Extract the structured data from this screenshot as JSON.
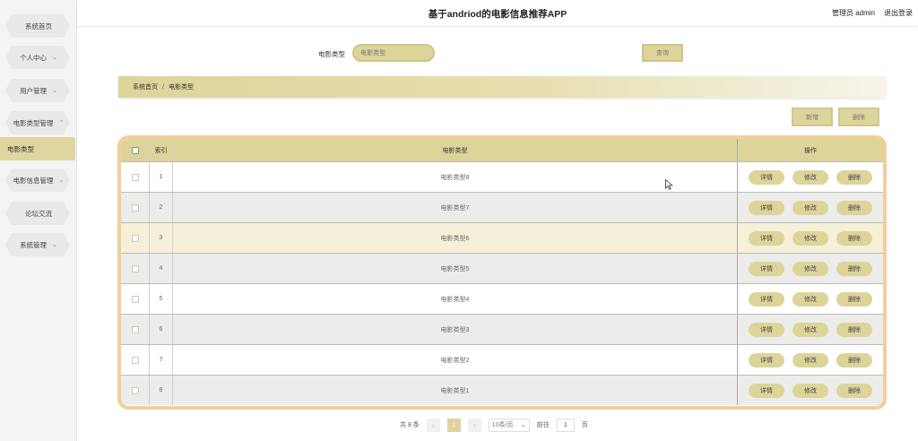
{
  "header": {
    "title": "基于andriod的电影信息推荐APP",
    "user": "管理员 admin",
    "logout": "退出登录"
  },
  "sidebar": {
    "items": [
      {
        "label": "系统首页",
        "chevron": false
      },
      {
        "label": "个人中心",
        "chevron": "⌄"
      },
      {
        "label": "用户管理",
        "chevron": "⌄"
      },
      {
        "label": "电影类型管理",
        "chevron": "⌃"
      },
      {
        "label": "电影类型",
        "chevron": false,
        "active": true
      },
      {
        "label": "电影信息管理",
        "chevron": "⌄"
      },
      {
        "label": "论坛交流",
        "chevron": false
      },
      {
        "label": "系统管理",
        "chevron": "⌄"
      }
    ]
  },
  "search": {
    "label": "电影类型",
    "placeholder": "电影类型",
    "button": "查询"
  },
  "breadcrumb": {
    "home": "系统首页",
    "separator": "/",
    "current": "电影类型"
  },
  "actions": {
    "add": "新增",
    "delete": "删除"
  },
  "table": {
    "columns": [
      "索引",
      "电影类型",
      "操作"
    ],
    "ops": {
      "detail": "详情",
      "edit": "修改",
      "delete": "删除"
    },
    "rows": [
      {
        "index": "1",
        "name": "电影类型8"
      },
      {
        "index": "2",
        "name": "电影类型7"
      },
      {
        "index": "3",
        "name": "电影类型6"
      },
      {
        "index": "4",
        "name": "电影类型5"
      },
      {
        "index": "5",
        "name": "电影类型4"
      },
      {
        "index": "6",
        "name": "电影类型3"
      },
      {
        "index": "7",
        "name": "电影类型2"
      },
      {
        "index": "8",
        "name": "电影类型1"
      }
    ]
  },
  "pagination": {
    "total": "共 8 条",
    "prev": "‹",
    "current_page": "1",
    "next": "›",
    "page_size": "10条/页",
    "goto_label": "前往",
    "goto_value": "1",
    "goto_suffix": "页"
  },
  "colors": {
    "accent": "#ddd49a",
    "table_border": "#f2cf9a",
    "highlight_row": "#f6f0d9"
  }
}
